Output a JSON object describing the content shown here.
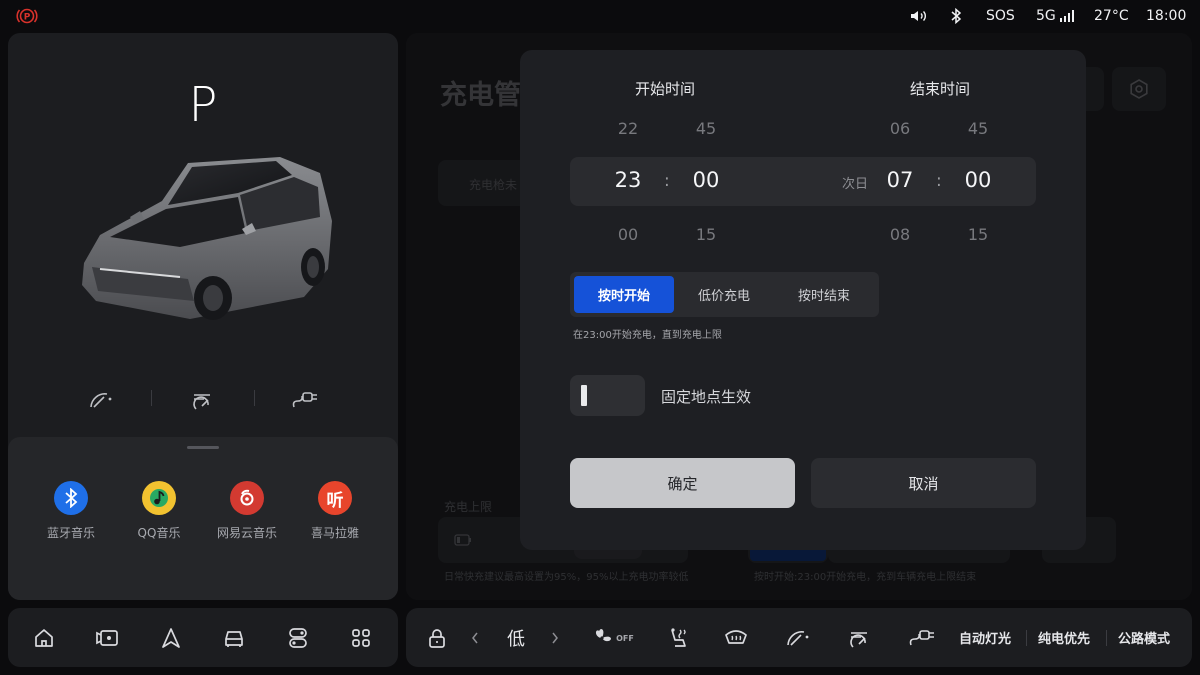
{
  "status_bar": {
    "sound_icon": "volume-icon",
    "bluetooth_icon": "bluetooth-icon",
    "sos": "SOS",
    "network": "5G",
    "temperature": "27°C",
    "time": "18:00",
    "parking_brake_color": "#d8322b"
  },
  "vehicle": {
    "gear": "P",
    "quick_actions": [
      "wiper-icon",
      "rear-wiper-icon",
      "charge-port-icon"
    ]
  },
  "media_apps": [
    {
      "label": "蓝牙音乐",
      "icon": "bluetooth-icon",
      "color": "#1f6fe8"
    },
    {
      "label": "QQ音乐",
      "icon": "qq-music-icon",
      "color": "#f2c230"
    },
    {
      "label": "网易云音乐",
      "icon": "netease-music-icon",
      "color": "#d33a31"
    },
    {
      "label": "喜马拉雅",
      "icon": "ximalaya-icon",
      "color": "#e8452c"
    }
  ],
  "background_page": {
    "title": "充电管",
    "tab_hint": "充电枪未",
    "charge_limit_label": "充电上限",
    "charge_limit_note": "日常快充建议最高设置为95%，95%以上充电功率较低",
    "schedule_note": "按时开始:23:00开始充电，充到车辆充电上限结束"
  },
  "dialog": {
    "start_header": "开始时间",
    "end_header": "结束时间",
    "start_time": {
      "hour_prev": "22",
      "hour": "23",
      "hour_next": "00",
      "minute_prev": "45",
      "minute": "00",
      "minute_next": "15"
    },
    "end_time": {
      "next_day_label": "次日",
      "hour_prev": "06",
      "hour": "07",
      "hour_next": "08",
      "minute_prev": "45",
      "minute": "00",
      "minute_next": "15"
    },
    "separator": ":",
    "modes": [
      "按时开始",
      "低价充电",
      "按时结束"
    ],
    "active_mode": "按时开始",
    "mode_description": "在23:00开始充电，直到充电上限",
    "fixed_location_label": "固定地点生效",
    "fixed_location_enabled": false,
    "confirm_label": "确定",
    "cancel_label": "取消",
    "accent_color": "#1552d8"
  },
  "dock": {
    "left_icons": [
      "home-icon",
      "camera-icon",
      "navigation-icon",
      "car-icon",
      "toggle-settings-icon",
      "apps-grid-icon"
    ],
    "lock_icon": "lock-icon",
    "fan_level": "低",
    "fan_status": "OFF",
    "climate_icons": [
      "seat-heat-icon",
      "defrost-icon",
      "wiper-icon",
      "rear-wiper-icon",
      "charge-port-icon"
    ],
    "auto_light": "自动灯光",
    "ev_priority": "纯电优先",
    "road_mode": "公路模式"
  }
}
